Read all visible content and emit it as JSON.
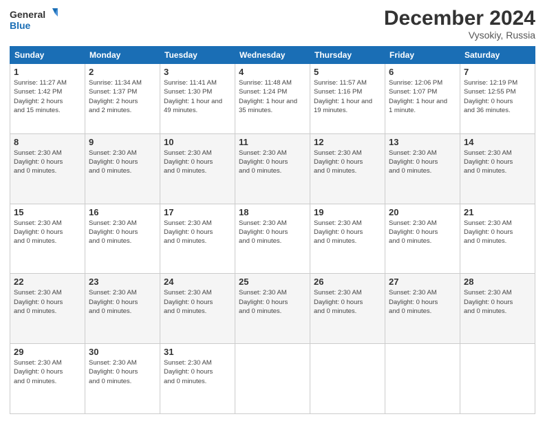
{
  "logo": {
    "line1": "General",
    "line2": "Blue"
  },
  "header": {
    "month": "December 2024",
    "location": "Vysokiy, Russia"
  },
  "days_of_week": [
    "Sunday",
    "Monday",
    "Tuesday",
    "Wednesday",
    "Thursday",
    "Friday",
    "Saturday"
  ],
  "weeks": [
    [
      {
        "day": "1",
        "info": "Sunrise: 11:27 AM\nSunset: 1:42 PM\nDaylight: 2 hours\nand 15 minutes."
      },
      {
        "day": "2",
        "info": "Sunrise: 11:34 AM\nSunset: 1:37 PM\nDaylight: 2 hours\nand 2 minutes."
      },
      {
        "day": "3",
        "info": "Sunrise: 11:41 AM\nSunset: 1:30 PM\nDaylight: 1 hour and\n49 minutes."
      },
      {
        "day": "4",
        "info": "Sunrise: 11:48 AM\nSunset: 1:24 PM\nDaylight: 1 hour and\n35 minutes."
      },
      {
        "day": "5",
        "info": "Sunrise: 11:57 AM\nSunset: 1:16 PM\nDaylight: 1 hour and\n19 minutes."
      },
      {
        "day": "6",
        "info": "Sunrise: 12:06 PM\nSunset: 1:07 PM\nDaylight: 1 hour and\n1 minute."
      },
      {
        "day": "7",
        "info": "Sunrise: 12:19 PM\nSunset: 12:55 PM\nDaylight: 0 hours\nand 36 minutes."
      }
    ],
    [
      {
        "day": "8",
        "info": "Sunset: 2:30 AM\nDaylight: 0 hours\nand 0 minutes."
      },
      {
        "day": "9",
        "info": "Sunset: 2:30 AM\nDaylight: 0 hours\nand 0 minutes."
      },
      {
        "day": "10",
        "info": "Sunset: 2:30 AM\nDaylight: 0 hours\nand 0 minutes."
      },
      {
        "day": "11",
        "info": "Sunset: 2:30 AM\nDaylight: 0 hours\nand 0 minutes."
      },
      {
        "day": "12",
        "info": "Sunset: 2:30 AM\nDaylight: 0 hours\nand 0 minutes."
      },
      {
        "day": "13",
        "info": "Sunset: 2:30 AM\nDaylight: 0 hours\nand 0 minutes."
      },
      {
        "day": "14",
        "info": "Sunset: 2:30 AM\nDaylight: 0 hours\nand 0 minutes."
      }
    ],
    [
      {
        "day": "15",
        "info": "Sunset: 2:30 AM\nDaylight: 0 hours\nand 0 minutes."
      },
      {
        "day": "16",
        "info": "Sunset: 2:30 AM\nDaylight: 0 hours\nand 0 minutes."
      },
      {
        "day": "17",
        "info": "Sunset: 2:30 AM\nDaylight: 0 hours\nand 0 minutes."
      },
      {
        "day": "18",
        "info": "Sunset: 2:30 AM\nDaylight: 0 hours\nand 0 minutes."
      },
      {
        "day": "19",
        "info": "Sunset: 2:30 AM\nDaylight: 0 hours\nand 0 minutes."
      },
      {
        "day": "20",
        "info": "Sunset: 2:30 AM\nDaylight: 0 hours\nand 0 minutes."
      },
      {
        "day": "21",
        "info": "Sunset: 2:30 AM\nDaylight: 0 hours\nand 0 minutes."
      }
    ],
    [
      {
        "day": "22",
        "info": "Sunset: 2:30 AM\nDaylight: 0 hours\nand 0 minutes."
      },
      {
        "day": "23",
        "info": "Sunset: 2:30 AM\nDaylight: 0 hours\nand 0 minutes."
      },
      {
        "day": "24",
        "info": "Sunset: 2:30 AM\nDaylight: 0 hours\nand 0 minutes."
      },
      {
        "day": "25",
        "info": "Sunset: 2:30 AM\nDaylight: 0 hours\nand 0 minutes."
      },
      {
        "day": "26",
        "info": "Sunset: 2:30 AM\nDaylight: 0 hours\nand 0 minutes."
      },
      {
        "day": "27",
        "info": "Sunset: 2:30 AM\nDaylight: 0 hours\nand 0 minutes."
      },
      {
        "day": "28",
        "info": "Sunset: 2:30 AM\nDaylight: 0 hours\nand 0 minutes."
      }
    ],
    [
      {
        "day": "29",
        "info": "Sunset: 2:30 AM\nDaylight: 0 hours\nand 0 minutes."
      },
      {
        "day": "30",
        "info": "Sunset: 2:30 AM\nDaylight: 0 hours\nand 0 minutes."
      },
      {
        "day": "31",
        "info": "Sunset: 2:30 AM\nDaylight: 0 hours\nand 0 minutes."
      },
      {
        "day": "",
        "info": ""
      },
      {
        "day": "",
        "info": ""
      },
      {
        "day": "",
        "info": ""
      },
      {
        "day": "",
        "info": ""
      }
    ]
  ]
}
